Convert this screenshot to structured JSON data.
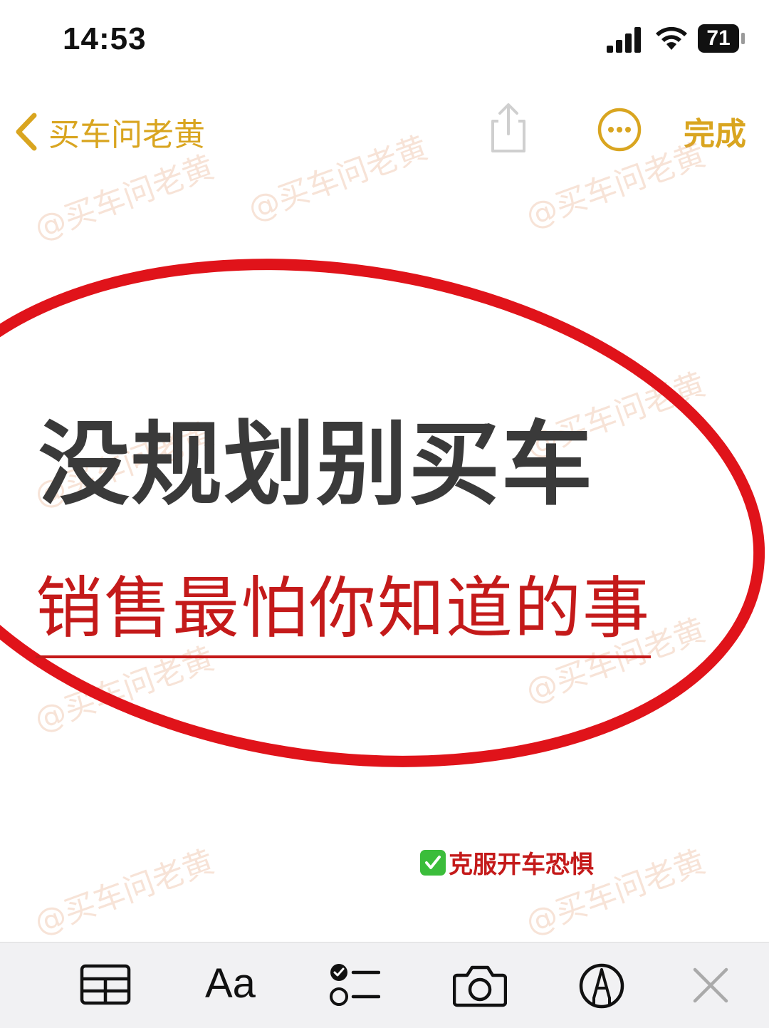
{
  "status_bar": {
    "time": "14:53",
    "battery": "71",
    "signal_icon": "cellular-signal-icon",
    "wifi_icon": "wifi-icon"
  },
  "nav": {
    "back_label": "买车问老黄",
    "back_icon": "chevron-left-icon",
    "share_icon": "share-icon",
    "more_icon": "ellipsis-circle-icon",
    "done_label": "完成"
  },
  "note": {
    "title": "没规划别买车",
    "subtitle": "销售最怕你知道的事",
    "tag": "克服开车恐惧",
    "tag_icon": "checkmark-box-icon"
  },
  "watermark": "@买车问老黄",
  "toolbar": {
    "items": [
      "table-icon",
      "text-format-icon",
      "checklist-icon",
      "camera-icon",
      "markup-pen-icon",
      "close-icon"
    ],
    "format_label": "Aa"
  },
  "colors": {
    "accent": "#d9a520",
    "title": "#3a3a3a",
    "subtitle": "#c41a1a",
    "ellipse": "#e0131a",
    "toolbar_bg": "#f1f1f3"
  }
}
